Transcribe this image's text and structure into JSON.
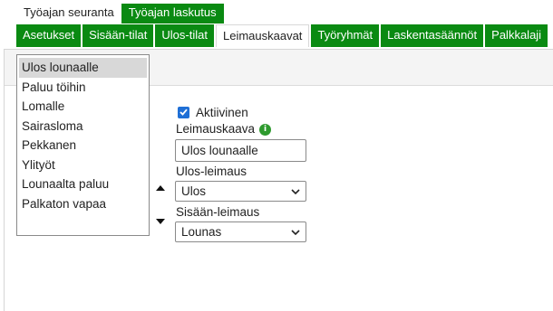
{
  "top_tabs": [
    {
      "label": "Työajan seuranta",
      "active": true
    },
    {
      "label": "Työajan laskutus",
      "active": false
    }
  ],
  "sub_tabs": [
    {
      "label": "Asetukset",
      "active": false
    },
    {
      "label": "Sisään-tilat",
      "active": false
    },
    {
      "label": "Ulos-tilat",
      "active": false
    },
    {
      "label": "Leimauskaavat",
      "active": true
    },
    {
      "label": "Työryhmät",
      "active": false
    },
    {
      "label": "Laskentasäännöt",
      "active": false
    },
    {
      "label": "Palkkalaji",
      "active": false
    }
  ],
  "panel": {
    "title": "Leimauskaavat"
  },
  "list": {
    "items": [
      "Ulos lounaalle",
      "Paluu töihin",
      "Lomalle",
      "Sairasloma",
      "Pekkanen",
      "Ylityöt",
      "Lounaalta paluu",
      "Palkaton vapaa"
    ],
    "selected": "Ulos lounaalle"
  },
  "form": {
    "active_label": "Aktiivinen",
    "active_checked": true,
    "name_label": "Leimauskaava",
    "name_info": "i",
    "name_value": "Ulos lounaalle",
    "out_label": "Ulos-leimaus",
    "out_value": "Ulos",
    "in_label": "Sisään-leimaus",
    "in_value": "Lounas"
  },
  "colors": {
    "accent_green": "#0a8a12",
    "checkbox_blue": "#1f6fd6",
    "info_green": "#2e9a2e"
  },
  "icons": {
    "move_up": "triangle-up-icon",
    "move_down": "triangle-down-icon",
    "select_arrow": "chevron-down-icon",
    "info": "info-icon",
    "check": "checkmark-icon"
  }
}
